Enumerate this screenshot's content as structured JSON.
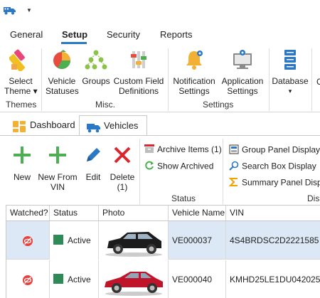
{
  "quick_access": {
    "app_icon": "truck-icon",
    "dropdown_icon": "caret-down-icon"
  },
  "ribbon_tabs": [
    {
      "label": "General"
    },
    {
      "label": "Setup",
      "active": true
    },
    {
      "label": "Security"
    },
    {
      "label": "Reports"
    }
  ],
  "ribbon": {
    "select_theme": {
      "line1": "Select",
      "line2": "Theme ▾"
    },
    "vehicle_statuses": {
      "line1": "Vehicle",
      "line2": "Statuses"
    },
    "groups": {
      "label": "Groups"
    },
    "custom_field": {
      "line1": "Custom Field",
      "line2": "Definitions"
    },
    "notification_settings": {
      "line1": "Notification",
      "line2": "Settings"
    },
    "application_settings": {
      "line1": "Application",
      "line2": "Settings"
    },
    "database": {
      "label": "Database",
      "caret": "▾"
    },
    "group_labels": {
      "themes": "Themes",
      "misc": "Misc.",
      "settings": "Settings"
    }
  },
  "doc_tabs": [
    {
      "label": "Dashboard"
    },
    {
      "label": "Vehicles",
      "active": true
    }
  ],
  "toolbar": {
    "new": {
      "label": "New"
    },
    "new_from_vin": {
      "line1": "New From",
      "line2": "VIN"
    },
    "edit": {
      "label": "Edit"
    },
    "delete": {
      "line1": "Delete",
      "line2": "(1)"
    },
    "archive_items": "Archive Items (1)",
    "show_archived": "Show Archived",
    "status_group": "Status",
    "group_panel_display": "Group Panel Display",
    "search_box_display": "Search Box Display",
    "summary_panel_display": "Summary Panel Displ",
    "display_group": "Dis"
  },
  "grid": {
    "headers": [
      "Watched?",
      "Status",
      "Photo",
      "Vehicle Name",
      "VIN"
    ],
    "rows": [
      {
        "status": "Active",
        "status_color": "#2e8b57",
        "vehicle_name": "VE000037",
        "vin": "4S4BRDSC2D2221585",
        "photo_color": "#1c1c1c"
      },
      {
        "status": "Active",
        "status_color": "#2e8b57",
        "vehicle_name": "VE000040",
        "vin": "KMHD25LE1DU042025",
        "photo_color": "#c0142a"
      }
    ]
  },
  "colors": {
    "accent": "#2b78c5",
    "selected_row": "#dce8f5",
    "delete_red": "#d9262f",
    "add_green": "#4caf50"
  }
}
